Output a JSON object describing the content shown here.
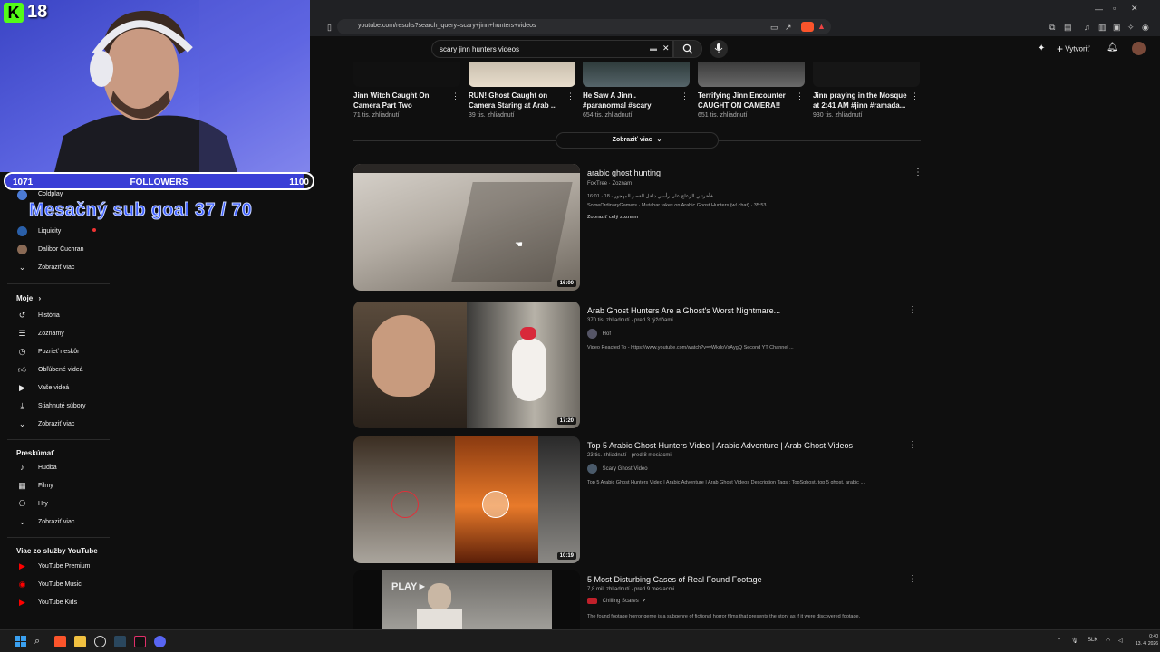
{
  "webcam": {
    "viewer_count": "18",
    "kick_logo": "K",
    "followers": {
      "current": "1071",
      "label": "FOLLOWERS",
      "goal": "1100",
      "progress": 0.974
    },
    "sub_goal": "Mesačný sub goal 37 / 70"
  },
  "browser": {
    "url": "youtube.com/results?search_query=scary+jinn+hunters+videos"
  },
  "masthead": {
    "search_value": "scary jinn hunters videos",
    "create_label": "Vytvoriť"
  },
  "sidebar": {
    "subscriptions": [
      {
        "label": "Coldplay",
        "icon": "channel-avatar"
      },
      {
        "label": "Liquicity",
        "icon": "channel-avatar"
      },
      {
        "label": "Dalibor Čuchran",
        "icon": "channel-avatar"
      },
      {
        "label": "Zobraziť viac",
        "icon": "chevron-down-icon"
      }
    ],
    "you_header": "Moje",
    "you_items": [
      {
        "label": "História",
        "icon": "history-icon"
      },
      {
        "label": "Zoznamy",
        "icon": "playlists-icon"
      },
      {
        "label": "Pozrieť neskôr",
        "icon": "clock-icon"
      },
      {
        "label": "Obľúbené videá",
        "icon": "thumbs-up-icon"
      },
      {
        "label": "Vaše videá",
        "icon": "play-box-icon"
      },
      {
        "label": "Stiahnuté súbory",
        "icon": "download-icon"
      },
      {
        "label": "Zobraziť viac",
        "icon": "chevron-down-icon"
      }
    ],
    "explore_header": "Preskúmať",
    "explore_items": [
      {
        "label": "Hudba",
        "icon": "music-note-icon"
      },
      {
        "label": "Filmy",
        "icon": "film-icon"
      },
      {
        "label": "Hry",
        "icon": "gamepad-icon"
      },
      {
        "label": "Zobraziť viac",
        "icon": "chevron-down-icon"
      }
    ],
    "more_header": "Viac zo služby YouTube",
    "more_items": [
      {
        "label": "YouTube Premium",
        "icon": "youtube-premium-icon"
      },
      {
        "label": "YouTube Music",
        "icon": "youtube-music-icon"
      },
      {
        "label": "YouTube Kids",
        "icon": "youtube-kids-icon"
      }
    ]
  },
  "shorts": [
    {
      "title": "Jinn Witch Caught On Camera Part Two",
      "views": "71 tis. zhliadnutí"
    },
    {
      "title": "RUN! Ghost Caught on Camera Staring at Arab ...",
      "views": "39 tis. zhliadnutí"
    },
    {
      "title": "He Saw A Jinn.. #paranormal #scary",
      "views": "654 tis. zhliadnutí"
    },
    {
      "title": "Terrifying Jinn Encounter CAUGHT ON CAMERA!!",
      "views": "651 tis. zhliadnutí"
    },
    {
      "title": "Jinn praying in the Mosque at 2:41 AM #jinn #ramada...",
      "views": "930 tis. zhliadnutí"
    }
  ],
  "show_more_label": "Zobraziť viac",
  "results": [
    {
      "title": "arabic ghost hunting",
      "meta": "FoxTree · Zoznam",
      "channel": "",
      "desc_line1": "16:01 · أخرتني الزعاح على رأسي داخل القصر المهجور · 18+",
      "desc_line2": "SomeOrdinaryGamers · Mutahar takes on Arabic Ghost Hunters (w/ chat) · 35:53",
      "desc_line3": "Zobraziť celý zoznam",
      "duration": "16:00"
    },
    {
      "title": "Arab Ghost Hunters Are a Ghost's Worst Nightmare...",
      "meta": "370 tis. zhliadnutí · pred 3 týždňami",
      "channel": "Hof",
      "desc_line1": "Video Reacted To - https://www.youtube.com/watch?v=vWkdoVsAygQ Second YT Channel ...",
      "duration": "17:20"
    },
    {
      "title": "Top 5 Arabic Ghost Hunters Video | Arabic Adventure | Arab Ghost Videos",
      "meta": "23 tis. zhliadnutí · pred 8 mesiacmi",
      "channel": "Scary Ghost Video",
      "desc_line1": "Top 5 Arabic Ghost Hunters Video | Arabic Adventure | Arab Ghost Videos Description Tags : TopSghost, top 5 ghost, arabic ...",
      "duration": "10:19"
    },
    {
      "title": "5 Most Disturbing Cases of Real Found Footage",
      "meta": "7,8 mil. zhliadnutí · pred 9 mesiacmi",
      "channel": "Chilling Scares",
      "desc_line1": "The found footage horror genre is a subgenre of fictional horror films that presents the story as if it were discovered footage.",
      "duration": "",
      "thumb_text": "PLAY►"
    }
  ],
  "taskbar": {
    "lang": "SLK",
    "time": "0:40",
    "date": "13. 4. 2026"
  }
}
